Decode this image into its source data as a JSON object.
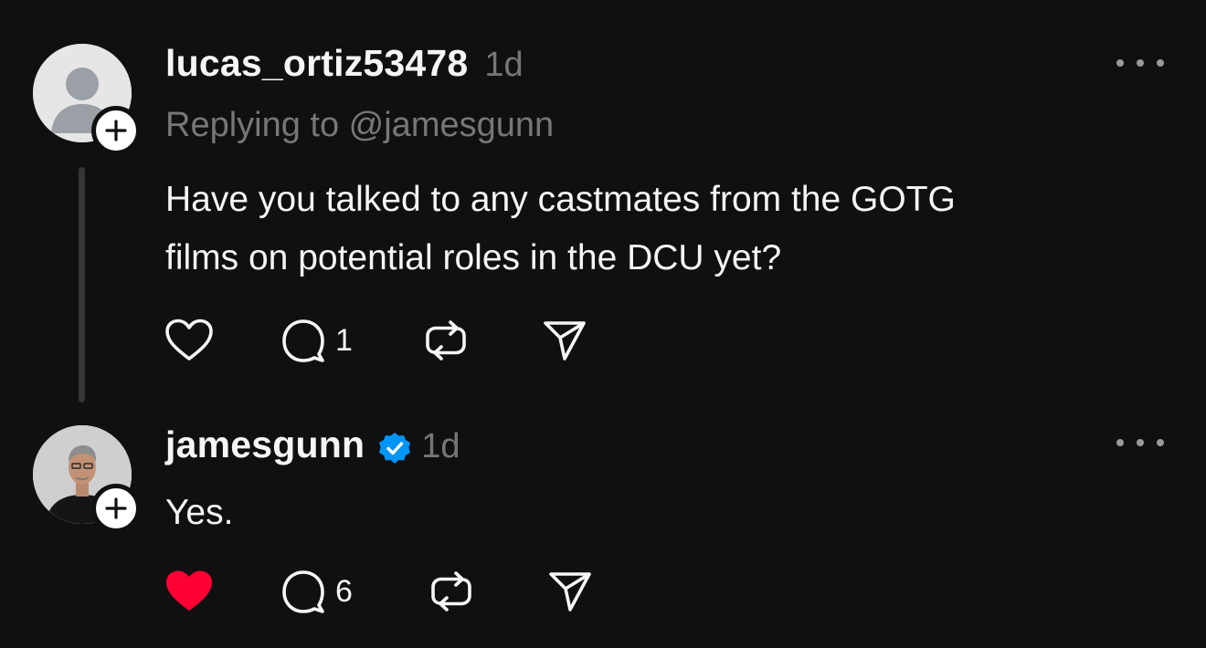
{
  "posts": [
    {
      "username": "lucas_ortiz53478",
      "time": "1d",
      "replying_to": "Replying to @jamesgunn",
      "text_lines": [
        "Have you talked to any castmates from the GOTG",
        "films on potential roles in the DCU yet?"
      ],
      "reply_count": "1",
      "liked": false,
      "icons": [
        "heart-icon",
        "comment-icon",
        "repost-icon",
        "share-icon",
        "more-icon",
        "plus-icon"
      ]
    },
    {
      "username": "jamesgunn",
      "verified": true,
      "time": "1d",
      "text_lines": [
        "Yes."
      ],
      "reply_count": "6",
      "liked": true,
      "icons": [
        "heart-filled-icon",
        "comment-icon",
        "repost-icon",
        "share-icon",
        "more-icon",
        "plus-icon",
        "verified-badge-icon"
      ]
    }
  ],
  "colors": {
    "background": "#101010",
    "primary_text": "#f3f5f7",
    "secondary_text": "#777777",
    "thread_line": "#363636",
    "like_active": "#ff0034",
    "verified": "#0095f6"
  }
}
